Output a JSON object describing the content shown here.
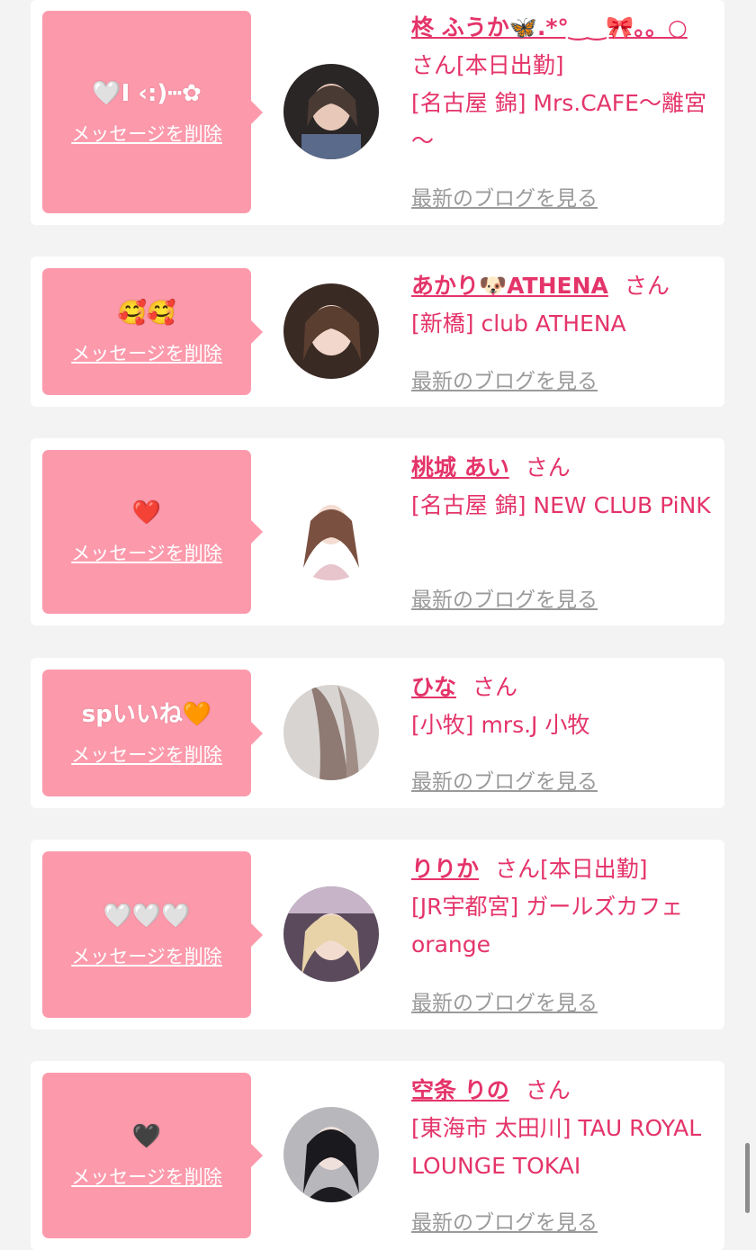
{
  "cards": [
    {
      "message": "🤍I ‹:)┅✿",
      "delete_label": "メッセージを削除",
      "name": "柊 ふうか🦋.*°‿‿🎀。。○",
      "honorific": "さん",
      "status": "[本日出勤]",
      "shop": "[名古屋 錦] Mrs.CAFE～離宮～",
      "blog_label": "最新のブログを見る"
    },
    {
      "message": "🥰🥰",
      "delete_label": "メッセージを削除",
      "name": "あかり🐶ATHENA",
      "honorific": "さん",
      "status": "",
      "shop": "[新橋] club ATHENA",
      "blog_label": "最新のブログを見る"
    },
    {
      "message": "❤️",
      "delete_label": "メッセージを削除",
      "name": "桃城 あい",
      "honorific": "さん",
      "status": "",
      "shop": "[名古屋 錦] NEW CLUB PiNK",
      "blog_label": "最新のブログを見る"
    },
    {
      "message": "spいいね🧡",
      "delete_label": "メッセージを削除",
      "name": "ひな",
      "honorific": "さん",
      "status": "",
      "shop": "[小牧] mrs.J 小牧",
      "blog_label": "最新のブログを見る"
    },
    {
      "message": "🤍🤍🤍",
      "delete_label": "メッセージを削除",
      "name": "りりか",
      "honorific": "さん",
      "status": "[本日出勤]",
      "shop": "[JR宇都宮] ガールズカフェ orange",
      "blog_label": "最新のブログを見る"
    },
    {
      "message": "🖤",
      "delete_label": "メッセージを削除",
      "name": "空条 りの",
      "honorific": "さん",
      "status": "",
      "shop": "[東海市 太田川] TAU ROYAL LOUNGE TOKAI",
      "blog_label": "最新のブログを見る"
    }
  ],
  "colors": {
    "page_bg": "#f3f3f3",
    "card_bg": "#ffffff",
    "bubble": "#fc9aac",
    "accent_text": "#e4346a",
    "link_gray": "#9a9a9a"
  }
}
